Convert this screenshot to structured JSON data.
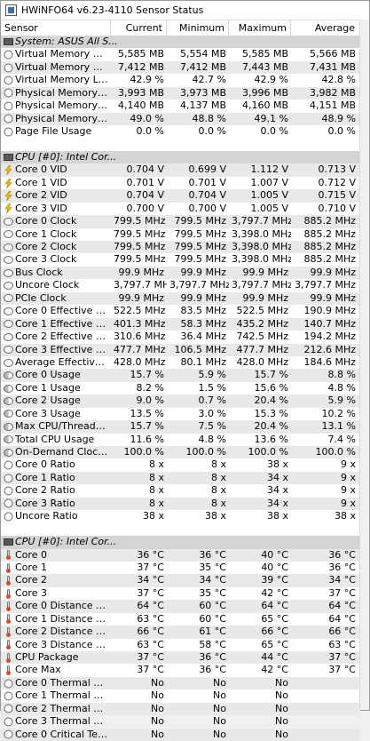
{
  "window": {
    "title": "HWiNFO64 v6.23-4110 Sensor Status"
  },
  "columns": {
    "sensor": "Sensor",
    "current": "Current",
    "minimum": "Minimum",
    "maximum": "Maximum",
    "average": "Average"
  },
  "groups": [
    {
      "title": "System: ASUS All S...",
      "rows": [
        {
          "icon": "circle-icon",
          "label": "Virtual Memory Com...",
          "current": "5,585 MB",
          "minimum": "5,554 MB",
          "maximum": "5,585 MB",
          "average": "5,566 MB"
        },
        {
          "icon": "circle-icon",
          "label": "Virtual Memory Avai...",
          "current": "7,412 MB",
          "minimum": "7,412 MB",
          "maximum": "7,443 MB",
          "average": "7,431 MB"
        },
        {
          "icon": "circle-icon",
          "label": "Virtual Memory Load",
          "current": "42.9 %",
          "minimum": "42.7 %",
          "maximum": "42.9 %",
          "average": "42.8 %"
        },
        {
          "icon": "circle-icon",
          "label": "Physical Memory Used",
          "current": "3,993 MB",
          "minimum": "3,973 MB",
          "maximum": "3,996 MB",
          "average": "3,982 MB"
        },
        {
          "icon": "circle-icon",
          "label": "Physical Memory Av...",
          "current": "4,140 MB",
          "minimum": "4,137 MB",
          "maximum": "4,160 MB",
          "average": "4,151 MB"
        },
        {
          "icon": "circle-icon",
          "label": "Physical Memory Load",
          "current": "49.0 %",
          "minimum": "48.8 %",
          "maximum": "49.1 %",
          "average": "48.9 %"
        },
        {
          "icon": "circle-icon",
          "label": "Page File Usage",
          "current": "0.0 %",
          "minimum": "0.0 %",
          "maximum": "0.0 %",
          "average": "0.0 %"
        }
      ]
    },
    {
      "title": "CPU [#0]: Intel Cor...",
      "rows": [
        {
          "icon": "bolt-icon",
          "label": "Core 0 VID",
          "current": "0.704 V",
          "minimum": "0.699 V",
          "maximum": "1.112 V",
          "average": "0.713 V"
        },
        {
          "icon": "bolt-icon",
          "label": "Core 1 VID",
          "current": "0.701 V",
          "minimum": "0.701 V",
          "maximum": "1.007 V",
          "average": "0.712 V"
        },
        {
          "icon": "bolt-icon",
          "label": "Core 2 VID",
          "current": "0.704 V",
          "minimum": "0.704 V",
          "maximum": "1.005 V",
          "average": "0.715 V"
        },
        {
          "icon": "bolt-icon",
          "label": "Core 3 VID",
          "current": "0.700 V",
          "minimum": "0.700 V",
          "maximum": "1.005 V",
          "average": "0.710 V"
        },
        {
          "icon": "clock-icon",
          "label": "Core 0 Clock",
          "current": "799.5 MHz",
          "minimum": "799.5 MHz",
          "maximum": "3,797.7 MHz",
          "average": "885.2 MHz"
        },
        {
          "icon": "clock-icon",
          "label": "Core 1 Clock",
          "current": "799.5 MHz",
          "minimum": "799.5 MHz",
          "maximum": "3,398.0 MHz",
          "average": "885.2 MHz"
        },
        {
          "icon": "clock-icon",
          "label": "Core 2 Clock",
          "current": "799.5 MHz",
          "minimum": "799.5 MHz",
          "maximum": "3,398.0 MHz",
          "average": "885.2 MHz"
        },
        {
          "icon": "clock-icon",
          "label": "Core 3 Clock",
          "current": "799.5 MHz",
          "minimum": "799.5 MHz",
          "maximum": "3,398.0 MHz",
          "average": "885.2 MHz"
        },
        {
          "icon": "clock-icon",
          "label": "Bus Clock",
          "current": "99.9 MHz",
          "minimum": "99.9 MHz",
          "maximum": "99.9 MHz",
          "average": "99.9 MHz"
        },
        {
          "icon": "clock-icon",
          "label": "Uncore Clock",
          "current": "3,797.7 MHz",
          "minimum": "3,797.7 MHz",
          "maximum": "3,797.7 MHz",
          "average": "3,797.7 MHz"
        },
        {
          "icon": "clock-icon",
          "label": "PCIe Clock",
          "current": "99.9 MHz",
          "minimum": "99.9 MHz",
          "maximum": "99.9 MHz",
          "average": "99.9 MHz"
        },
        {
          "icon": "clock-icon",
          "label": "Core 0 Effective Clock",
          "current": "522.5 MHz",
          "minimum": "83.5 MHz",
          "maximum": "522.5 MHz",
          "average": "190.9 MHz"
        },
        {
          "icon": "clock-icon",
          "label": "Core 1 Effective Clock",
          "current": "401.3 MHz",
          "minimum": "58.3 MHz",
          "maximum": "435.2 MHz",
          "average": "140.7 MHz"
        },
        {
          "icon": "clock-icon",
          "label": "Core 2 Effective Clock",
          "current": "310.6 MHz",
          "minimum": "36.4 MHz",
          "maximum": "742.5 MHz",
          "average": "194.2 MHz"
        },
        {
          "icon": "clock-icon",
          "label": "Core 3 Effective Clock",
          "current": "477.7 MHz",
          "minimum": "106.5 MHz",
          "maximum": "477.7 MHz",
          "average": "212.6 MHz"
        },
        {
          "icon": "clock-icon",
          "label": "Average Effective ...",
          "current": "428.0 MHz",
          "minimum": "80.1 MHz",
          "maximum": "428.0 MHz",
          "average": "184.6 MHz"
        },
        {
          "icon": "percent-icon",
          "label": "Core 0 Usage",
          "current": "15.7 %",
          "minimum": "5.9 %",
          "maximum": "15.7 %",
          "average": "8.8 %"
        },
        {
          "icon": "percent-icon",
          "label": "Core 1 Usage",
          "current": "8.2 %",
          "minimum": "1.5 %",
          "maximum": "15.6 %",
          "average": "4.8 %"
        },
        {
          "icon": "percent-icon",
          "label": "Core 2 Usage",
          "current": "9.0 %",
          "minimum": "0.7 %",
          "maximum": "20.4 %",
          "average": "5.9 %"
        },
        {
          "icon": "percent-icon",
          "label": "Core 3 Usage",
          "current": "13.5 %",
          "minimum": "3.0 %",
          "maximum": "15.3 %",
          "average": "10.2 %"
        },
        {
          "icon": "percent-icon",
          "label": "Max CPU/Thread U...",
          "current": "15.7 %",
          "minimum": "7.5 %",
          "maximum": "20.4 %",
          "average": "13.1 %"
        },
        {
          "icon": "percent-icon",
          "label": "Total CPU Usage",
          "current": "11.6 %",
          "minimum": "4.8 %",
          "maximum": "13.6 %",
          "average": "7.4 %"
        },
        {
          "icon": "percent-icon",
          "label": "On-Demand Clock ...",
          "current": "100.0 %",
          "minimum": "100.0 %",
          "maximum": "100.0 %",
          "average": "100.0 %"
        },
        {
          "icon": "circle-icon",
          "label": "Core 0 Ratio",
          "current": "8 x",
          "minimum": "8 x",
          "maximum": "38 x",
          "average": "9 x"
        },
        {
          "icon": "circle-icon",
          "label": "Core 1 Ratio",
          "current": "8 x",
          "minimum": "8 x",
          "maximum": "34 x",
          "average": "9 x"
        },
        {
          "icon": "circle-icon",
          "label": "Core 2 Ratio",
          "current": "8 x",
          "minimum": "8 x",
          "maximum": "34 x",
          "average": "9 x"
        },
        {
          "icon": "circle-icon",
          "label": "Core 3 Ratio",
          "current": "8 x",
          "minimum": "8 x",
          "maximum": "34 x",
          "average": "9 x"
        },
        {
          "icon": "circle-icon",
          "label": "Uncore Ratio",
          "current": "38 x",
          "minimum": "38 x",
          "maximum": "38 x",
          "average": "38 x"
        }
      ]
    },
    {
      "title": "CPU [#0]: Intel Cor...",
      "rows": [
        {
          "icon": "thermometer-icon",
          "label": "Core 0",
          "current": "36 °C",
          "minimum": "36 °C",
          "maximum": "40 °C",
          "average": "36 °C"
        },
        {
          "icon": "thermometer-icon",
          "label": "Core 1",
          "current": "37 °C",
          "minimum": "35 °C",
          "maximum": "40 °C",
          "average": "36 °C"
        },
        {
          "icon": "thermometer-icon",
          "label": "Core 2",
          "current": "34 °C",
          "minimum": "34 °C",
          "maximum": "39 °C",
          "average": "34 °C"
        },
        {
          "icon": "thermometer-icon",
          "label": "Core 3",
          "current": "37 °C",
          "minimum": "35 °C",
          "maximum": "42 °C",
          "average": "37 °C"
        },
        {
          "icon": "thermometer-icon",
          "label": "Core 0 Distance to ...",
          "current": "64 °C",
          "minimum": "60 °C",
          "maximum": "64 °C",
          "average": "64 °C"
        },
        {
          "icon": "thermometer-icon",
          "label": "Core 1 Distance to ...",
          "current": "63 °C",
          "minimum": "60 °C",
          "maximum": "65 °C",
          "average": "64 °C"
        },
        {
          "icon": "thermometer-icon",
          "label": "Core 2 Distance to ...",
          "current": "66 °C",
          "minimum": "61 °C",
          "maximum": "66 °C",
          "average": "66 °C"
        },
        {
          "icon": "thermometer-icon",
          "label": "Core 3 Distance to ...",
          "current": "63 °C",
          "minimum": "58 °C",
          "maximum": "65 °C",
          "average": "63 °C"
        },
        {
          "icon": "thermometer-icon",
          "label": "CPU Package",
          "current": "37 °C",
          "minimum": "36 °C",
          "maximum": "44 °C",
          "average": "37 °C"
        },
        {
          "icon": "thermometer-icon",
          "label": "Core Max",
          "current": "37 °C",
          "minimum": "36 °C",
          "maximum": "42 °C",
          "average": "37 °C"
        },
        {
          "icon": "circle-icon",
          "label": "Core 0 Thermal Thr...",
          "current": "No",
          "minimum": "No",
          "maximum": "No",
          "average": ""
        },
        {
          "icon": "circle-icon",
          "label": "Core 1 Thermal Thr...",
          "current": "No",
          "minimum": "No",
          "maximum": "No",
          "average": ""
        },
        {
          "icon": "circle-icon",
          "label": "Core 2 Thermal Thr...",
          "current": "No",
          "minimum": "No",
          "maximum": "No",
          "average": ""
        },
        {
          "icon": "circle-icon",
          "label": "Core 3 Thermal Thr...",
          "current": "No",
          "minimum": "No",
          "maximum": "No",
          "average": ""
        },
        {
          "icon": "circle-icon",
          "label": "Core 0 Critical Tem...",
          "current": "No",
          "minimum": "No",
          "maximum": "No",
          "average": ""
        }
      ]
    }
  ]
}
